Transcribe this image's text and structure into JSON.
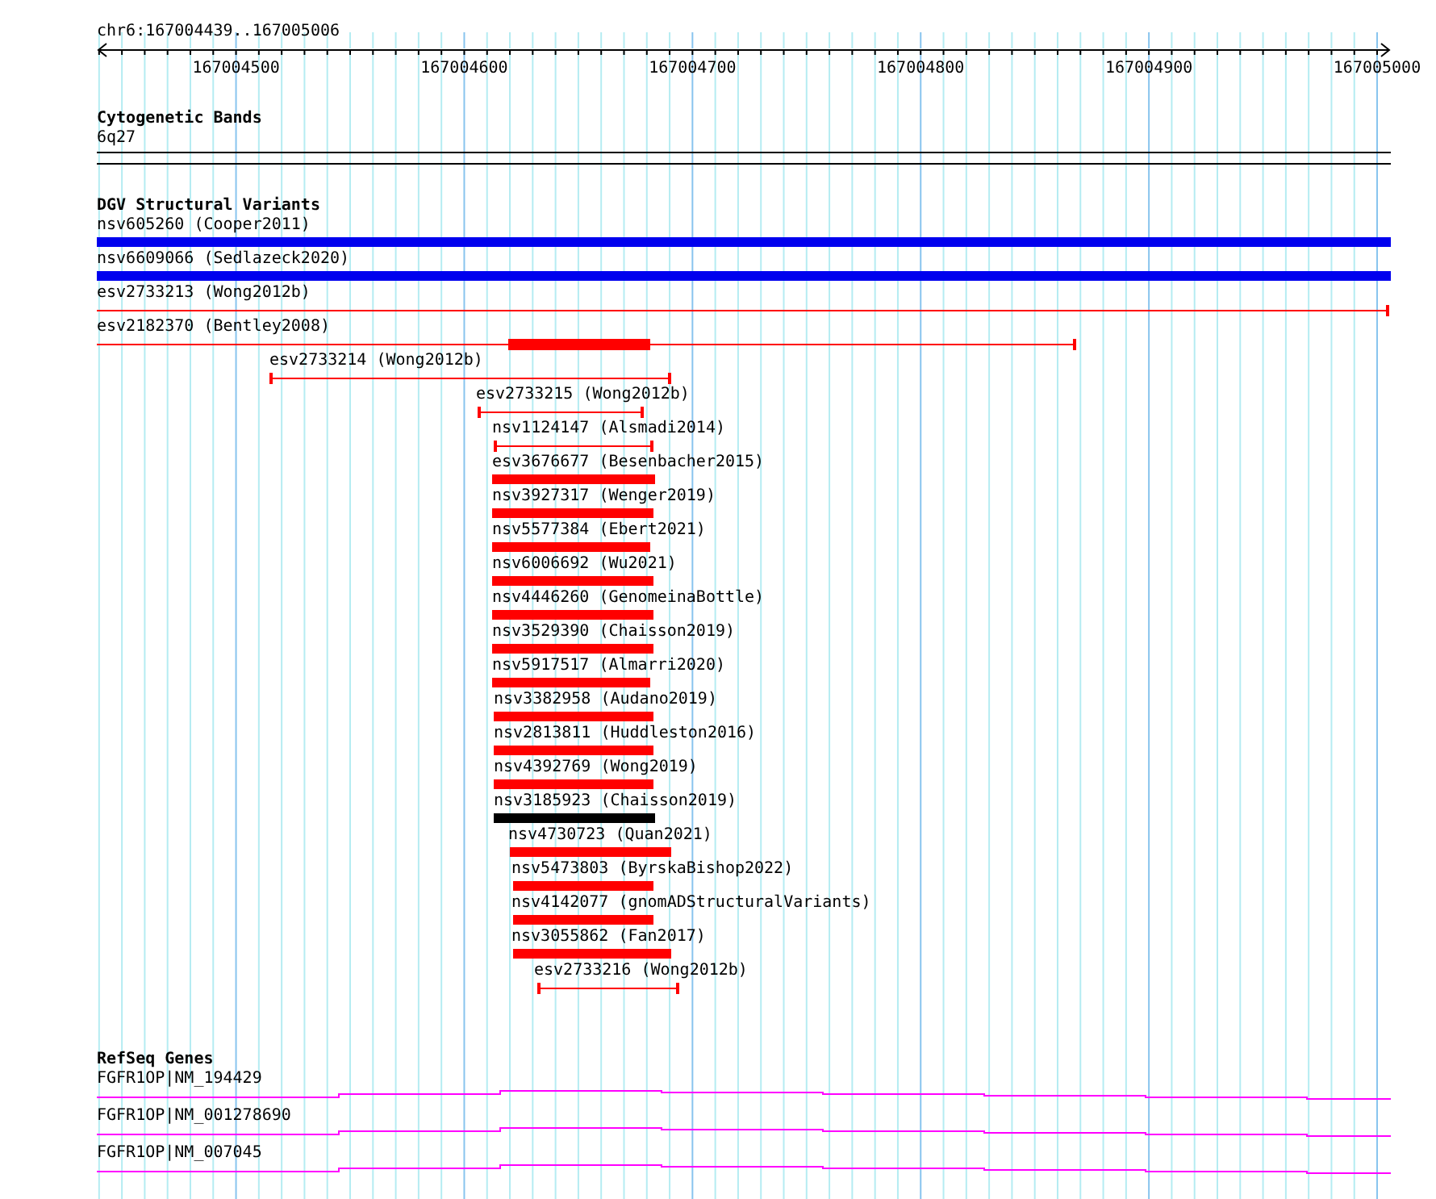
{
  "location": "chr6:167004439..167005006",
  "ruler": {
    "ticks": [
      "167004500",
      "167004600",
      "167004700",
      "167004800",
      "167004900",
      "167005000"
    ]
  },
  "cytoband_track": {
    "title": "Cytogenetic Bands",
    "band": "6q27"
  },
  "dgv_track": {
    "title": "DGV Structural Variants",
    "features": [
      {
        "label": "nsv605260 (Cooper2011)",
        "kind": "block",
        "color": "#0000ee"
      },
      {
        "label": "nsv6609066 (Sedlazeck2020)",
        "kind": "block",
        "color": "#0000ee"
      },
      {
        "label": "esv2733213 (Wong2012b)",
        "kind": "span",
        "color": "#ff0000"
      },
      {
        "label": "esv2182370 (Bentley2008)",
        "kind": "span-block",
        "color": "#ff0000"
      },
      {
        "label": "esv2733214 (Wong2012b)",
        "kind": "span",
        "color": "#ff0000"
      },
      {
        "label": "esv2733215 (Wong2012b)",
        "kind": "span",
        "color": "#ff0000"
      },
      {
        "label": "nsv1124147 (Alsmadi2014)",
        "kind": "span",
        "color": "#ff0000"
      },
      {
        "label": "esv3676677 (Besenbacher2015)",
        "kind": "block",
        "color": "#ff0000"
      },
      {
        "label": "nsv3927317 (Wenger2019)",
        "kind": "block",
        "color": "#ff0000"
      },
      {
        "label": "nsv5577384 (Ebert2021)",
        "kind": "block",
        "color": "#ff0000"
      },
      {
        "label": "nsv6006692 (Wu2021)",
        "kind": "block",
        "color": "#ff0000"
      },
      {
        "label": "nsv4446260 (GenomeinaBottle)",
        "kind": "block",
        "color": "#ff0000"
      },
      {
        "label": "nsv3529390 (Chaisson2019)",
        "kind": "block",
        "color": "#ff0000"
      },
      {
        "label": "nsv5917517 (Almarri2020)",
        "kind": "block",
        "color": "#ff0000"
      },
      {
        "label": "nsv3382958 (Audano2019)",
        "kind": "block",
        "color": "#ff0000"
      },
      {
        "label": "nsv2813811 (Huddleston2016)",
        "kind": "block",
        "color": "#ff0000"
      },
      {
        "label": "nsv4392769 (Wong2019)",
        "kind": "block",
        "color": "#ff0000"
      },
      {
        "label": "nsv3185923 (Chaisson2019)",
        "kind": "block",
        "color": "#000000"
      },
      {
        "label": "nsv4730723 (Quan2021)",
        "kind": "block",
        "color": "#ff0000"
      },
      {
        "label": "nsv5473803 (ByrskaBishop2022)",
        "kind": "block",
        "color": "#ff0000"
      },
      {
        "label": "nsv4142077 (gnomADStructuralVariants)",
        "kind": "block",
        "color": "#ff0000"
      },
      {
        "label": "nsv3055862 (Fan2017)",
        "kind": "block",
        "color": "#ff0000"
      },
      {
        "label": "esv2733216 (Wong2012b)",
        "kind": "span",
        "color": "#ff0000"
      }
    ]
  },
  "refseq_track": {
    "title": "RefSeq Genes",
    "genes": [
      {
        "label": "FGFR1OP|NM_194429"
      },
      {
        "label": "FGFR1OP|NM_001278690"
      },
      {
        "label": "FGFR1OP|NM_007045"
      }
    ]
  }
}
